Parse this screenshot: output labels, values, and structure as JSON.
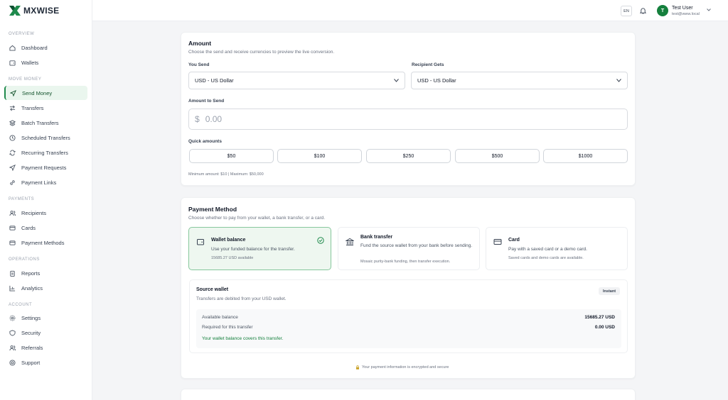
{
  "brand": {
    "name": "MXWISE",
    "accent": "#1f8a4c"
  },
  "sidebar": {
    "sections": {
      "overview": "OVERVIEW",
      "move_money": "MOVE MONEY",
      "payments": "PAYMENTS",
      "operations": "OPERATIONS",
      "account": "ACCOUNT"
    },
    "items": [
      {
        "label": "Dashboard",
        "icon": "home-icon"
      },
      {
        "label": "Wallets",
        "icon": "wallet-icon"
      },
      {
        "label": "Send Money",
        "icon": "send-icon",
        "active": true
      },
      {
        "label": "Transfers",
        "icon": "arrows-icon"
      },
      {
        "label": "Batch Transfers",
        "icon": "layers-icon"
      },
      {
        "label": "Scheduled Transfers",
        "icon": "clock-icon"
      },
      {
        "label": "Recurring Transfers",
        "icon": "repeat-icon"
      },
      {
        "label": "Payment Requests",
        "icon": "request-icon"
      },
      {
        "label": "Payment Links",
        "icon": "link-icon"
      },
      {
        "label": "Recipients",
        "icon": "users-icon"
      },
      {
        "label": "Cards",
        "icon": "card-icon"
      },
      {
        "label": "Payment Methods",
        "icon": "card-icon"
      },
      {
        "label": "Reports",
        "icon": "clipboard-icon"
      },
      {
        "label": "Analytics",
        "icon": "chart-icon"
      },
      {
        "label": "Settings",
        "icon": "gear-icon"
      },
      {
        "label": "Security",
        "icon": "shield-icon"
      },
      {
        "label": "Referrals",
        "icon": "users-icon"
      },
      {
        "label": "Support",
        "icon": "lifebuoy-icon"
      }
    ]
  },
  "topbar": {
    "lang": "EN",
    "user": {
      "initial": "T",
      "name": "Test User",
      "email": "test@www.local"
    }
  },
  "amount_card": {
    "title": "Amount",
    "subtitle": "Choose the send and receive currencies to preview the live conversion.",
    "you_send_label": "You Send",
    "you_send_value": "USD - US Dollar",
    "recipient_label": "Recipient Gets",
    "recipient_value": "USD - US Dollar",
    "amount_label": "Amount to Send",
    "currency_symbol": "$",
    "amount_placeholder": "0.00",
    "quick_label": "Quick amounts",
    "quick_amounts": [
      "$50",
      "$100",
      "$250",
      "$500",
      "$1000"
    ],
    "limits_note": "Minimum amount: $10 | Maximum: $50,000"
  },
  "payment_card": {
    "title": "Payment Method",
    "subtitle": "Choose whether to pay from your wallet, a bank transfer, or a card.",
    "methods": [
      {
        "title": "Wallet balance",
        "desc": "Use your funded balance for the transfer.",
        "note": "15685.27 USD available",
        "selected": true
      },
      {
        "title": "Bank transfer",
        "desc": "Fund the source wallet from your bank before sending.",
        "note": "Mosaic purity-bank funding, then transfer execution."
      },
      {
        "title": "Card",
        "desc": "Pay with a saved card or a demo card.",
        "note": "Saved cards and demo cards are available."
      }
    ],
    "source_wallet": {
      "title": "Source wallet",
      "desc": "Transfers are debited from your USD wallet.",
      "badge": "Instant",
      "available_label": "Available balance",
      "available_value": "15685.27 USD",
      "required_label": "Required for this transfer",
      "required_value": "0.00 USD",
      "ok_message": "Your wallet balance covers this transfer."
    },
    "secure_note": "Your payment information is encrypted and secure"
  }
}
